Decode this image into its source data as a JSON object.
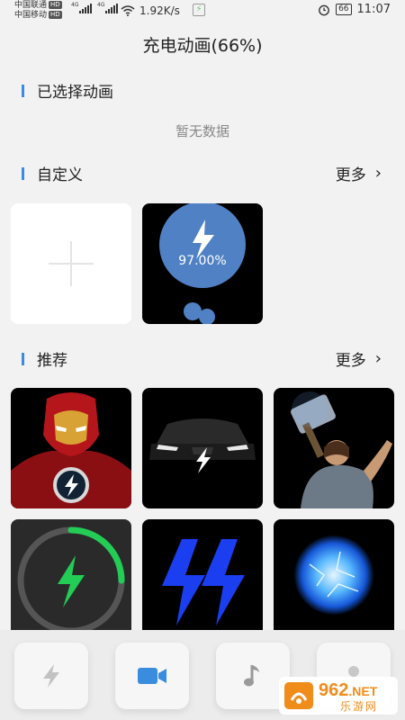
{
  "status_bar": {
    "carrier1": "中国联通",
    "carrier2": "中国移动",
    "hd_tag": "HD",
    "network_label": "4G",
    "net_speed": "1.92K/s",
    "battery": "66",
    "time": "11:07"
  },
  "page": {
    "title": "充电动画(66%)"
  },
  "selected_section": {
    "title": "已选择动画",
    "empty_text": "暂无数据"
  },
  "custom_section": {
    "title": "自定义",
    "more_label": "更多",
    "preview_percent": "97.00%"
  },
  "recommend_section": {
    "title": "推荐",
    "more_label": "更多",
    "items": [
      "iron-man",
      "car-headlights",
      "thor-hammer",
      "green-ring-bolt",
      "blue-double-bolt",
      "blue-energy-orb"
    ]
  },
  "bottom_nav": {
    "tabs": [
      "bolt-icon",
      "video-camera-icon",
      "music-note-icon",
      "person-icon"
    ],
    "active_index": 1
  },
  "watermark": {
    "brand_number": "962",
    "brand_net": ".NET",
    "brand_cn": "乐游网"
  },
  "colors": {
    "accent": "#3a8dde",
    "green": "#22cc55",
    "bolt_blue": "#1a3ef0"
  }
}
